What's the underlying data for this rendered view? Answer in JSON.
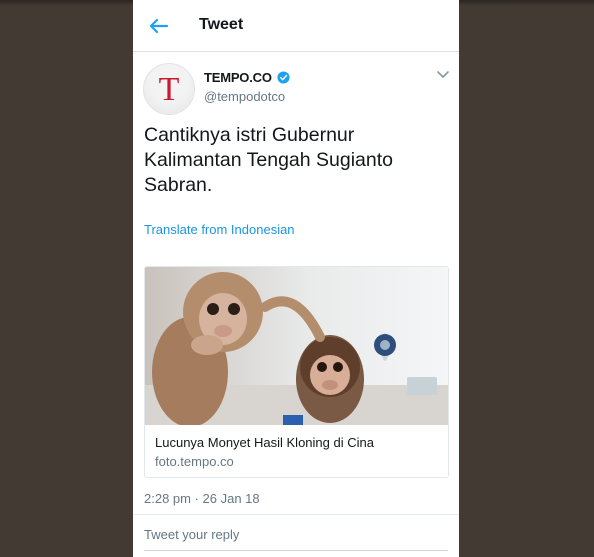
{
  "header": {
    "title": "Tweet",
    "back_icon": "arrow-left-icon",
    "accent": "#1da1f2"
  },
  "author": {
    "avatar_letter": "T",
    "avatar_color": "#c8192e",
    "display_name": "TEMPO.CO",
    "handle": "@tempodotco",
    "verified_icon": "verified-badge-icon",
    "menu_icon": "chevron-down-icon"
  },
  "tweet": {
    "text": "Cantiknya istri Gubernur Kalimantan Tengah Sugianto Sabran.",
    "translate_label": "Translate from Indonesian",
    "timestamp": "2:28 pm · 26 Jan 18"
  },
  "card": {
    "image_description_icon": "photo-two-baby-monkeys",
    "title": "Lucunya Monyet Hasil Kloning di Cina",
    "domain": "foto.tempo.co"
  },
  "reply": {
    "placeholder": "Tweet your reply"
  }
}
